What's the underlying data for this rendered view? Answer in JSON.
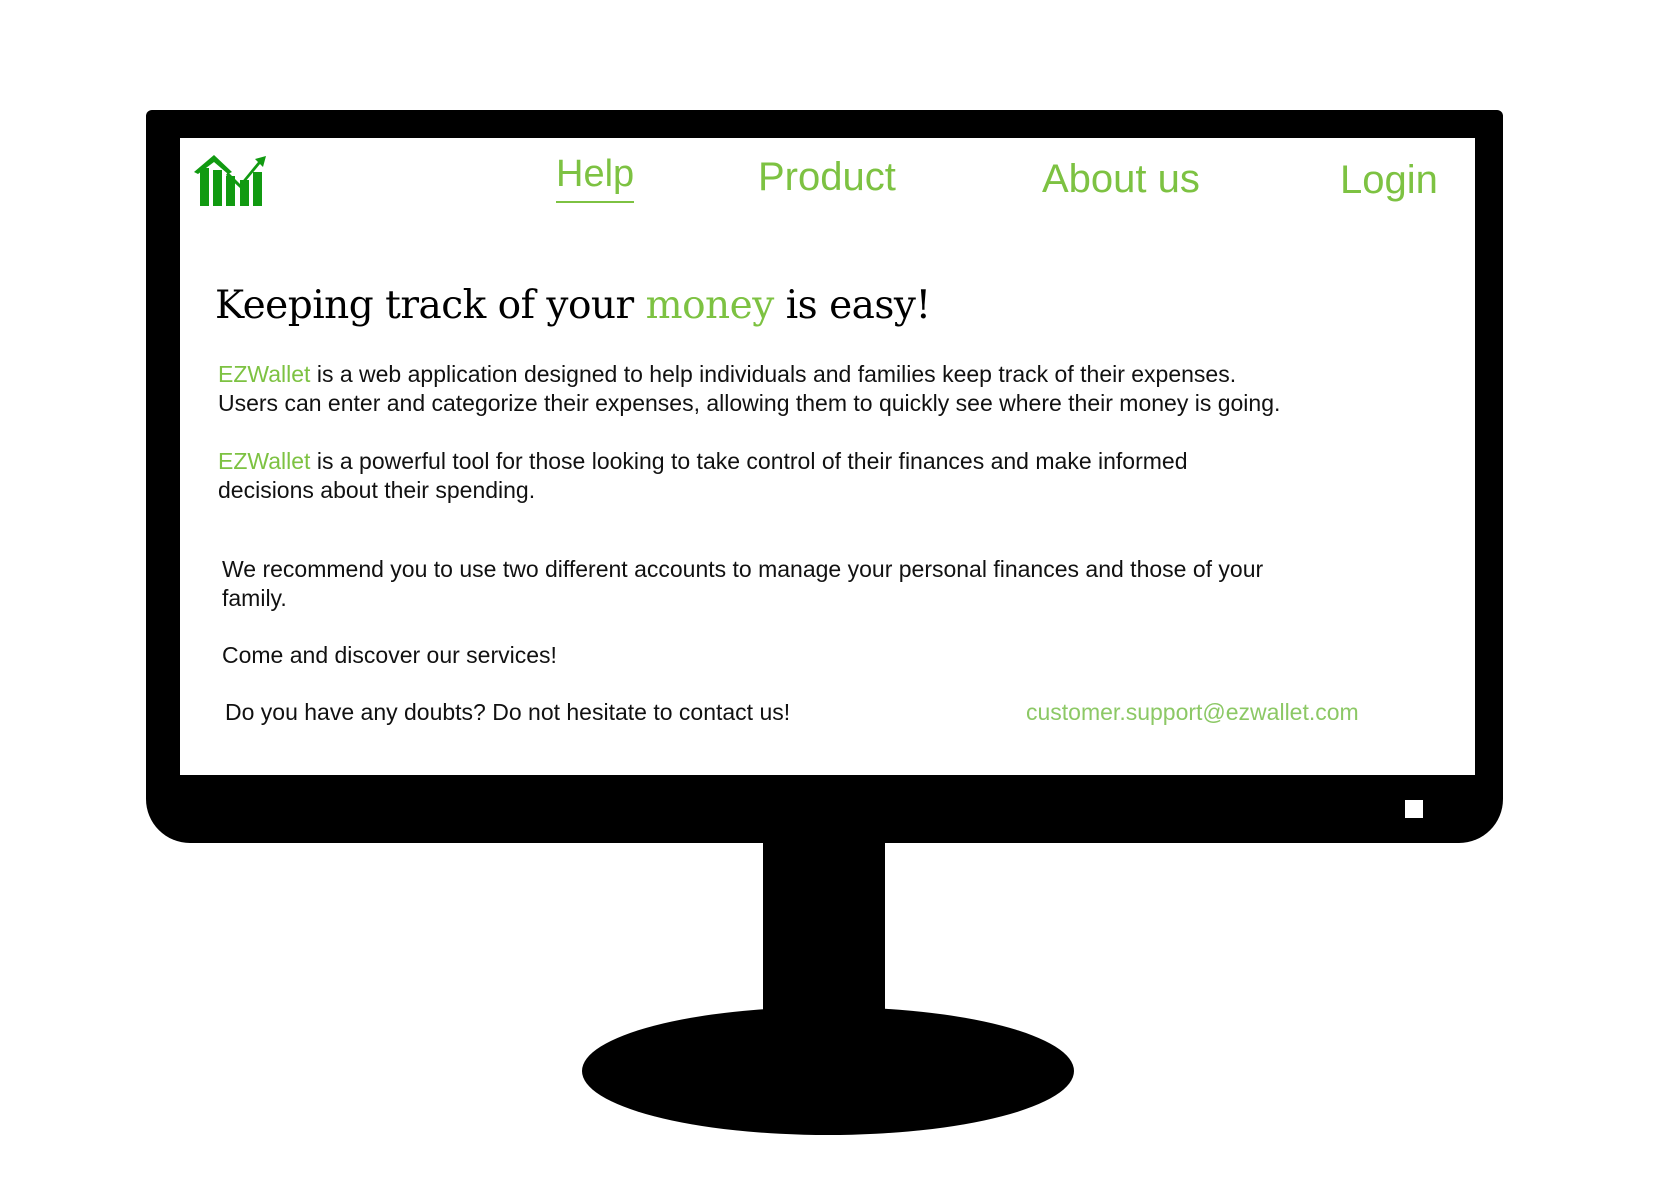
{
  "nav": {
    "help": "Help",
    "product": "Product",
    "about": "About us",
    "login": "Login"
  },
  "hero": {
    "title_before": "Keeping track of your ",
    "title_highlight": "money",
    "title_after": " is easy!"
  },
  "content": {
    "brand": "EZWallet",
    "p1_line1_rest": " is a web application designed to help individuals and families keep track of their expenses.",
    "p1_line2": "Users can enter and categorize their expenses, allowing them to quickly see where their money is going.",
    "p2_line1_rest": " is a powerful tool for those looking to take control of their finances and make informed",
    "p2_line2": "decisions about their spending.",
    "p3_line1": "We recommend you to use two different accounts to manage your personal finances and those of your",
    "p3_line2": "family.",
    "p4": "Come and discover our services!",
    "p5": "Do you have any doubts? Do not hesitate to contact us!",
    "email": "customer.support@ezwallet.com"
  },
  "colors": {
    "accent": "#7dc242",
    "logo_green": "#119a11",
    "monitor": "#000000"
  },
  "icons": {
    "logo": "bar-chart-trend-up-icon"
  }
}
